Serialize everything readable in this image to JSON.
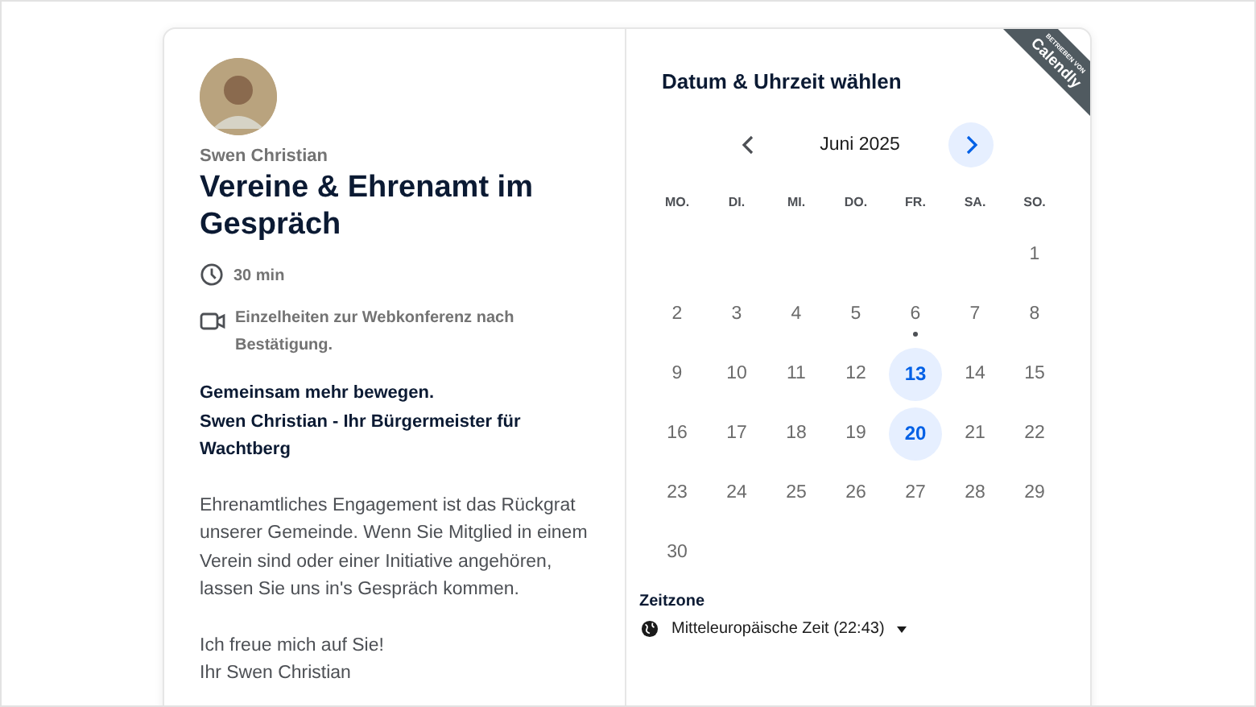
{
  "ribbon": {
    "caption": "BETRIEBEN VON",
    "brand": "Calendly"
  },
  "host": {
    "name": "Swen Christian"
  },
  "event": {
    "title": "Vereine & Ehrenamt im Gespräch",
    "duration": "30 min",
    "location": "Einzelheiten zur Webkonferenz nach Bestätigung."
  },
  "description": {
    "heading_lines": [
      "Gemeinsam mehr bewegen.",
      "Swen Christian - Ihr Bürgermeister für Wachtberg"
    ],
    "paragraphs": [
      "Ehrenamtliches Engagement ist das Rückgrat unserer Gemeinde. Wenn Sie Mitglied in einem Verein sind oder einer Initiative angehören, lassen Sie uns in's Gespräch kommen.",
      "Ich freue mich auf Sie!\nIhr Swen Christian"
    ]
  },
  "calendar": {
    "title": "Datum & Uhrzeit wählen",
    "month": "Juni 2025",
    "prev_disabled": true,
    "weekdays": [
      "MO.",
      "DI.",
      "MI.",
      "DO.",
      "FR.",
      "SA.",
      "SO."
    ],
    "weeks": [
      [
        {
          "label": "1",
          "available": false,
          "today": false
        }
      ],
      [
        {
          "label": "2",
          "available": false,
          "today": false
        },
        {
          "label": "3",
          "available": false,
          "today": false
        },
        {
          "label": "4",
          "available": false,
          "today": false
        },
        {
          "label": "5",
          "available": false,
          "today": false
        },
        {
          "label": "6",
          "available": false,
          "today": true
        },
        {
          "label": "7",
          "available": false,
          "today": false
        },
        {
          "label": "8",
          "available": false,
          "today": false
        }
      ],
      [
        {
          "label": "9",
          "available": false,
          "today": false
        },
        {
          "label": "10",
          "available": false,
          "today": false
        },
        {
          "label": "11",
          "available": false,
          "today": false
        },
        {
          "label": "12",
          "available": false,
          "today": false
        },
        {
          "label": "13",
          "available": true,
          "today": false
        },
        {
          "label": "14",
          "available": false,
          "today": false
        },
        {
          "label": "15",
          "available": false,
          "today": false
        }
      ],
      [
        {
          "label": "16",
          "available": false,
          "today": false
        },
        {
          "label": "17",
          "available": false,
          "today": false
        },
        {
          "label": "18",
          "available": false,
          "today": false
        },
        {
          "label": "19",
          "available": false,
          "today": false
        },
        {
          "label": "20",
          "available": true,
          "today": false
        },
        {
          "label": "21",
          "available": false,
          "today": false
        },
        {
          "label": "22",
          "available": false,
          "today": false
        }
      ],
      [
        {
          "label": "23",
          "available": false,
          "today": false
        },
        {
          "label": "24",
          "available": false,
          "today": false
        },
        {
          "label": "25",
          "available": false,
          "today": false
        },
        {
          "label": "26",
          "available": false,
          "today": false
        },
        {
          "label": "27",
          "available": false,
          "today": false
        },
        {
          "label": "28",
          "available": false,
          "today": false
        },
        {
          "label": "29",
          "available": false,
          "today": false
        }
      ],
      [
        {
          "label": "30",
          "available": false,
          "today": false
        }
      ]
    ]
  },
  "timezone": {
    "label": "Zeitzone",
    "value": "Mitteleuropäische Zeit (22:43)"
  }
}
